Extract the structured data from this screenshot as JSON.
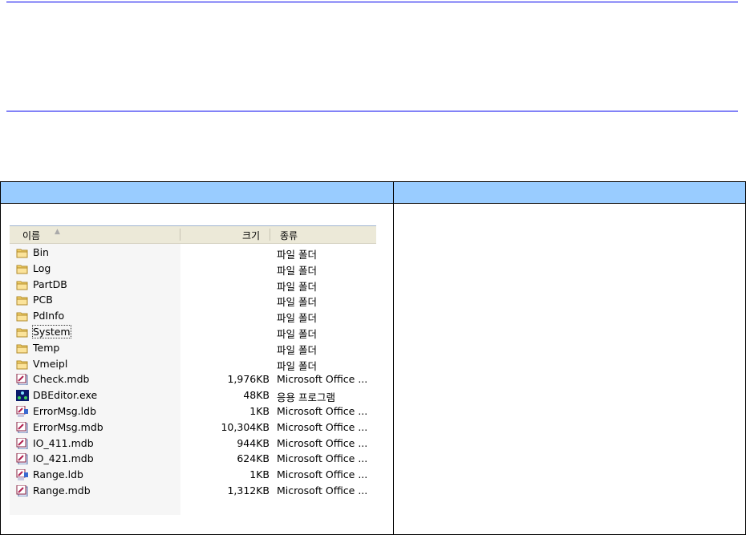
{
  "explorer": {
    "columns": {
      "name": "이름",
      "size": "크기",
      "type": "종류"
    },
    "files": [
      {
        "name": "Bin",
        "size": "",
        "type": "파일 폴더",
        "icon": "folder-icon"
      },
      {
        "name": "Log",
        "size": "",
        "type": "파일 폴더",
        "icon": "folder-icon"
      },
      {
        "name": "PartDB",
        "size": "",
        "type": "파일 폴더",
        "icon": "folder-icon"
      },
      {
        "name": "PCB",
        "size": "",
        "type": "파일 폴더",
        "icon": "folder-icon"
      },
      {
        "name": "PdInfo",
        "size": "",
        "type": "파일 폴더",
        "icon": "folder-icon"
      },
      {
        "name": "System",
        "size": "",
        "type": "파일 폴더",
        "icon": "folder-icon",
        "focused": true
      },
      {
        "name": "Temp",
        "size": "",
        "type": "파일 폴더",
        "icon": "folder-icon"
      },
      {
        "name": "Vmeipl",
        "size": "",
        "type": "파일 폴더",
        "icon": "folder-icon"
      },
      {
        "name": "Check.mdb",
        "size": "1,976KB",
        "type": "Microsoft Office ...",
        "icon": "access-db-icon"
      },
      {
        "name": "DBEditor.exe",
        "size": "48KB",
        "type": "응용 프로그램",
        "icon": "exe-app-icon"
      },
      {
        "name": "ErrorMsg.ldb",
        "size": "1KB",
        "type": "Microsoft Office ...",
        "icon": "access-lock-icon"
      },
      {
        "name": "ErrorMsg.mdb",
        "size": "10,304KB",
        "type": "Microsoft Office ...",
        "icon": "access-db-icon"
      },
      {
        "name": "IO_411.mdb",
        "size": "944KB",
        "type": "Microsoft Office ...",
        "icon": "access-db-icon"
      },
      {
        "name": "IO_421.mdb",
        "size": "624KB",
        "type": "Microsoft Office ...",
        "icon": "access-db-icon"
      },
      {
        "name": "Range.ldb",
        "size": "1KB",
        "type": "Microsoft Office ...",
        "icon": "access-lock-icon"
      },
      {
        "name": "Range.mdb",
        "size": "1,312KB",
        "type": "Microsoft Office ...",
        "icon": "access-db-icon"
      }
    ]
  },
  "colors": {
    "rule": "#0000ee",
    "table_header": "#99ccff",
    "explorer_header": "#ece9d8"
  }
}
